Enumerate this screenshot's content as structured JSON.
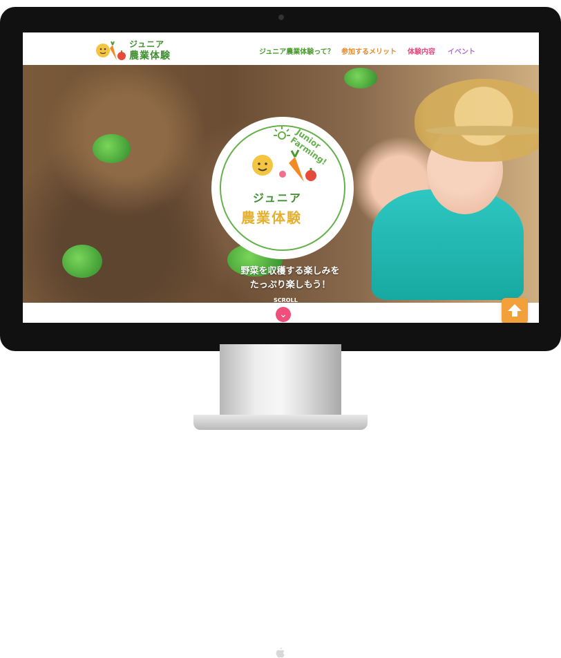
{
  "header": {
    "logo_line1": "ジュニア",
    "logo_line2": "農業体験",
    "nav": [
      {
        "label": "ジュニア農業体験って？"
      },
      {
        "label": "参加するメリット"
      },
      {
        "label": "体験内容"
      },
      {
        "label": "イベント"
      }
    ]
  },
  "hero": {
    "emblem_title_1": "ジュニア",
    "emblem_title_2": "農業体験",
    "emblem_subtitle": "Junior Farming!",
    "catch_copy_1": "野菜を収穫する楽しみを",
    "catch_copy_2": "たっぷり楽しもう！",
    "scroll_label": "SCROLL"
  },
  "icons": {
    "scroll": "chevron-down-icon",
    "back_to_top": "arrow-up-icon",
    "apple_logo": "apple-logo-icon"
  },
  "colors": {
    "green": "#4a9b2e",
    "orange": "#e58a2c",
    "pink": "#e24b7f",
    "purple": "#b26ad2",
    "top_button": "#f2a13a"
  }
}
